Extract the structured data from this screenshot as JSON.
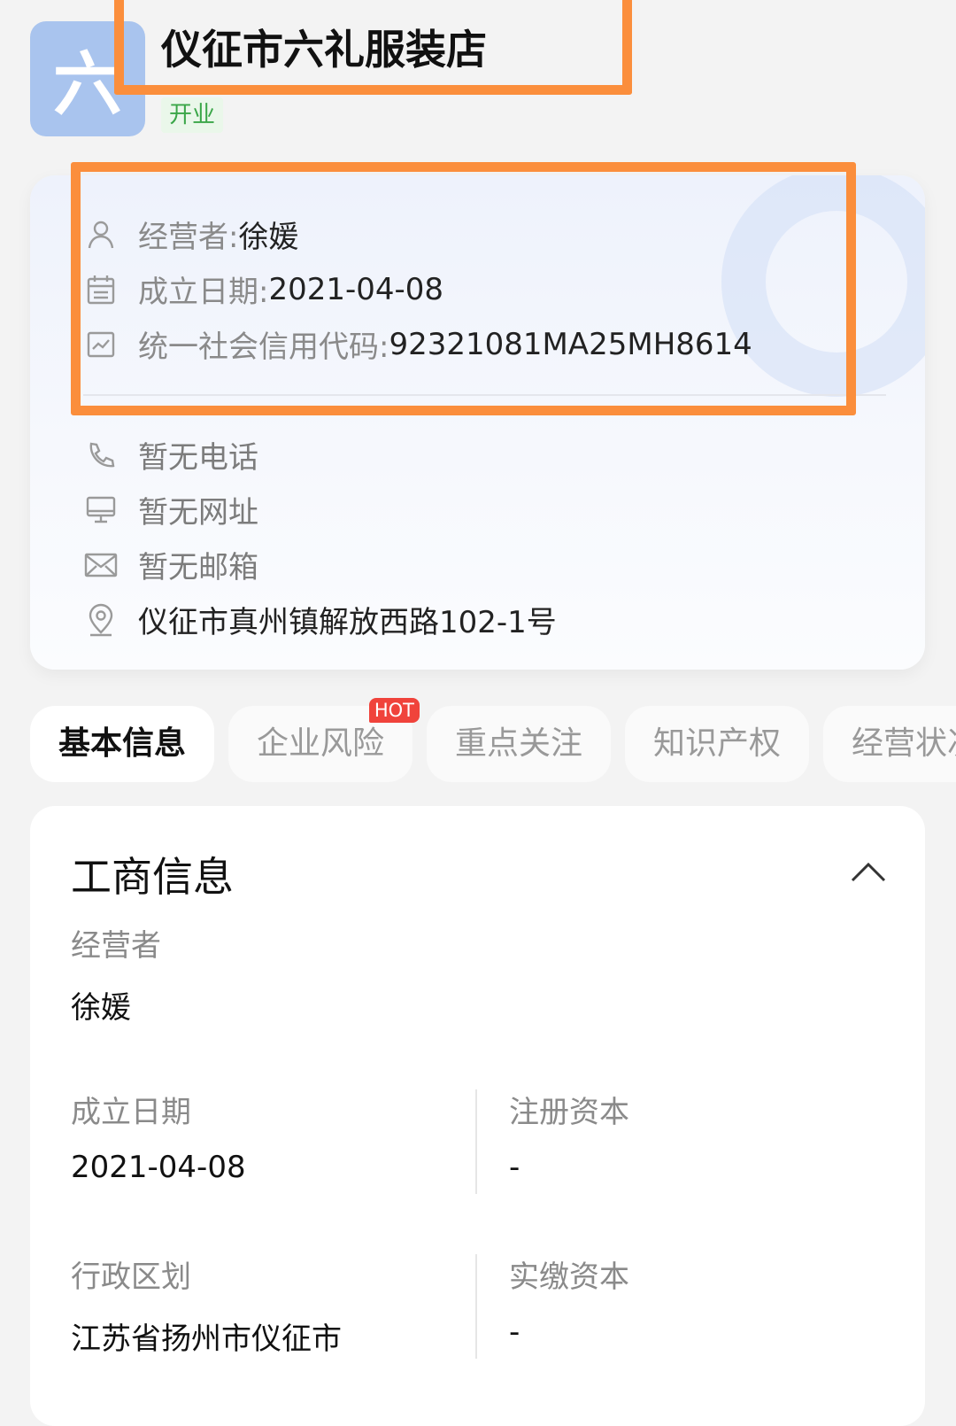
{
  "company": {
    "logo_char": "六",
    "name": "仪征市六礼服装店",
    "status": "开业"
  },
  "info_card": {
    "operator_label": "经营者:",
    "operator": "徐媛",
    "date_label": "成立日期:",
    "date": "2021-04-08",
    "credit_label": "统一社会信用代码:",
    "credit_code": "92321081MA25MH8614",
    "phone": "暂无电话",
    "website": "暂无网址",
    "email": "暂无邮箱",
    "address": "仪征市真州镇解放西路102-1号"
  },
  "tabs": [
    {
      "label": "基本信息",
      "active": true
    },
    {
      "label": "企业风险",
      "badge": "HOT"
    },
    {
      "label": "重点关注"
    },
    {
      "label": "知识产权"
    },
    {
      "label": "经营状况"
    }
  ],
  "business": {
    "title": "工商信息",
    "operator_label": "经营者",
    "operator": "徐媛",
    "date_label": "成立日期",
    "date": "2021-04-08",
    "capital_label": "注册资本",
    "capital": "-",
    "region_label": "行政区划",
    "region": "江苏省扬州市仪征市",
    "paid_label": "实缴资本",
    "paid": "-"
  },
  "colors": {
    "highlight": "#fb8e3c",
    "logo_bg": "#a9c4ee",
    "status_green": "#3aa648",
    "hot_red": "#f0433b"
  }
}
